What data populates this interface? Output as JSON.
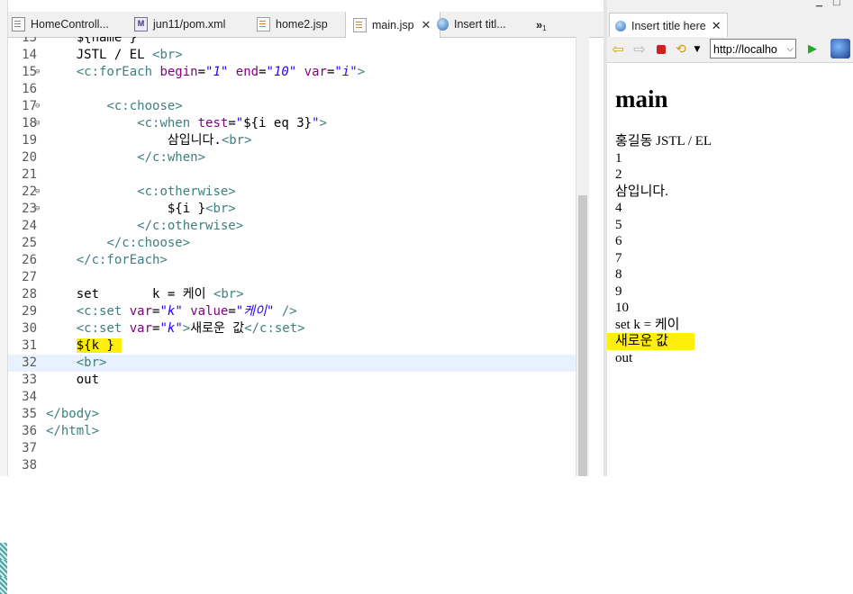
{
  "editor": {
    "tabs": [
      {
        "label": "HomeControll...",
        "icon": "java-file-icon"
      },
      {
        "label": "jun11/pom.xml",
        "icon": "maven-icon"
      },
      {
        "label": "home2.jsp",
        "icon": "jsp-file-icon"
      },
      {
        "label": "main.jsp",
        "icon": "jsp-file-icon",
        "close": "✕"
      },
      {
        "label": "Insert titl...",
        "icon": "globe-icon"
      }
    ],
    "overflow": "»",
    "overflow_count": "1",
    "lines": [
      {
        "num": "13",
        "html": "    ${name }"
      },
      {
        "num": "14",
        "html": "    JSTL / EL <span class='tg'>&lt;br&gt;</span>"
      },
      {
        "num": "15",
        "html": "    <span class='tg'>&lt;c:forEach</span> <span class='at'>begin</span>=<span class='val'>\"1\"</span> <span class='at'>end</span>=<span class='val'>\"10\"</span> <span class='at'>var</span>=<span class='val'>\"i\"</span><span class='tg'>&gt;</span>",
        "fold": true
      },
      {
        "num": "16",
        "html": ""
      },
      {
        "num": "17",
        "html": "        <span class='tg'>&lt;c:choose&gt;</span>",
        "fold": true
      },
      {
        "num": "18",
        "html": "            <span class='tg'>&lt;c:when</span> <span class='at'>test</span>=<span class='val'>\"</span><span class='el'>${i eq 3}</span><span class='val'>\"</span><span class='tg'>&gt;</span>",
        "fold": true
      },
      {
        "num": "19",
        "html": "                삼입니다.<span class='tg'>&lt;br&gt;</span>"
      },
      {
        "num": "20",
        "html": "            <span class='tg'>&lt;/c:when&gt;</span>"
      },
      {
        "num": "21",
        "html": ""
      },
      {
        "num": "22",
        "html": "            <span class='tg'>&lt;c:otherwise&gt;</span>",
        "fold": true
      },
      {
        "num": "23",
        "html": "                ${i }<span class='tg'>&lt;br&gt;</span>",
        "fold": true
      },
      {
        "num": "24",
        "html": "            <span class='tg'>&lt;/c:otherwise&gt;</span>"
      },
      {
        "num": "25",
        "html": "        <span class='tg'>&lt;/c:choose&gt;</span>"
      },
      {
        "num": "26",
        "html": "    <span class='tg'>&lt;/c:forEach&gt;</span>"
      },
      {
        "num": "27",
        "html": ""
      },
      {
        "num": "28",
        "html": "    set       k = 케이 <span class='tg'>&lt;br&gt;</span>"
      },
      {
        "num": "29",
        "html": "    <span class='tg'>&lt;c:set</span> <span class='at'>var</span>=<span class='val'>\"k\"</span> <span class='at'>value</span>=<span class='val'>\"케이\"</span> <span class='tg'>/&gt;</span>"
      },
      {
        "num": "30",
        "html": "    <span class='tg'>&lt;c:set</span> <span class='at'>var</span>=<span class='val'>\"k\"</span><span class='tg'>&gt;</span>새로운 값<span class='tg'>&lt;/c:set&gt;</span>"
      },
      {
        "num": "31",
        "html": "    <span class='hl'>${k } </span>"
      },
      {
        "num": "32",
        "html": "    <span class='tg'>&lt;br&gt;</span>",
        "current": true
      },
      {
        "num": "33",
        "html": "    out"
      },
      {
        "num": "34",
        "html": ""
      },
      {
        "num": "35",
        "html": "<span class='tg'>&lt;/body&gt;</span>"
      },
      {
        "num": "36",
        "html": "<span class='tg'>&lt;/html&gt;</span>"
      },
      {
        "num": "37",
        "html": ""
      },
      {
        "num": "38",
        "html": ""
      }
    ]
  },
  "browser": {
    "tab_label": "Insert title here",
    "tab_close": "✕",
    "url": "http://localho",
    "toolbar_icons": [
      "back-arrow-icon",
      "forward-arrow-icon",
      "stop-icon",
      "refresh-icon",
      "dropdown-icon",
      "go-icon",
      "globe-icon"
    ],
    "heading": "main",
    "lines": [
      "홍길동 JSTL / EL",
      "1",
      "2",
      "삼입니다.",
      "4",
      "5",
      "6",
      "7",
      "8",
      "9",
      "10",
      "set k = 케이",
      "새로운 값",
      "out"
    ],
    "highlight_line": "새로운 값",
    "highlight_color": "#ffef0a"
  },
  "window_controls": {
    "minimize": "▁",
    "maximize": "□"
  }
}
